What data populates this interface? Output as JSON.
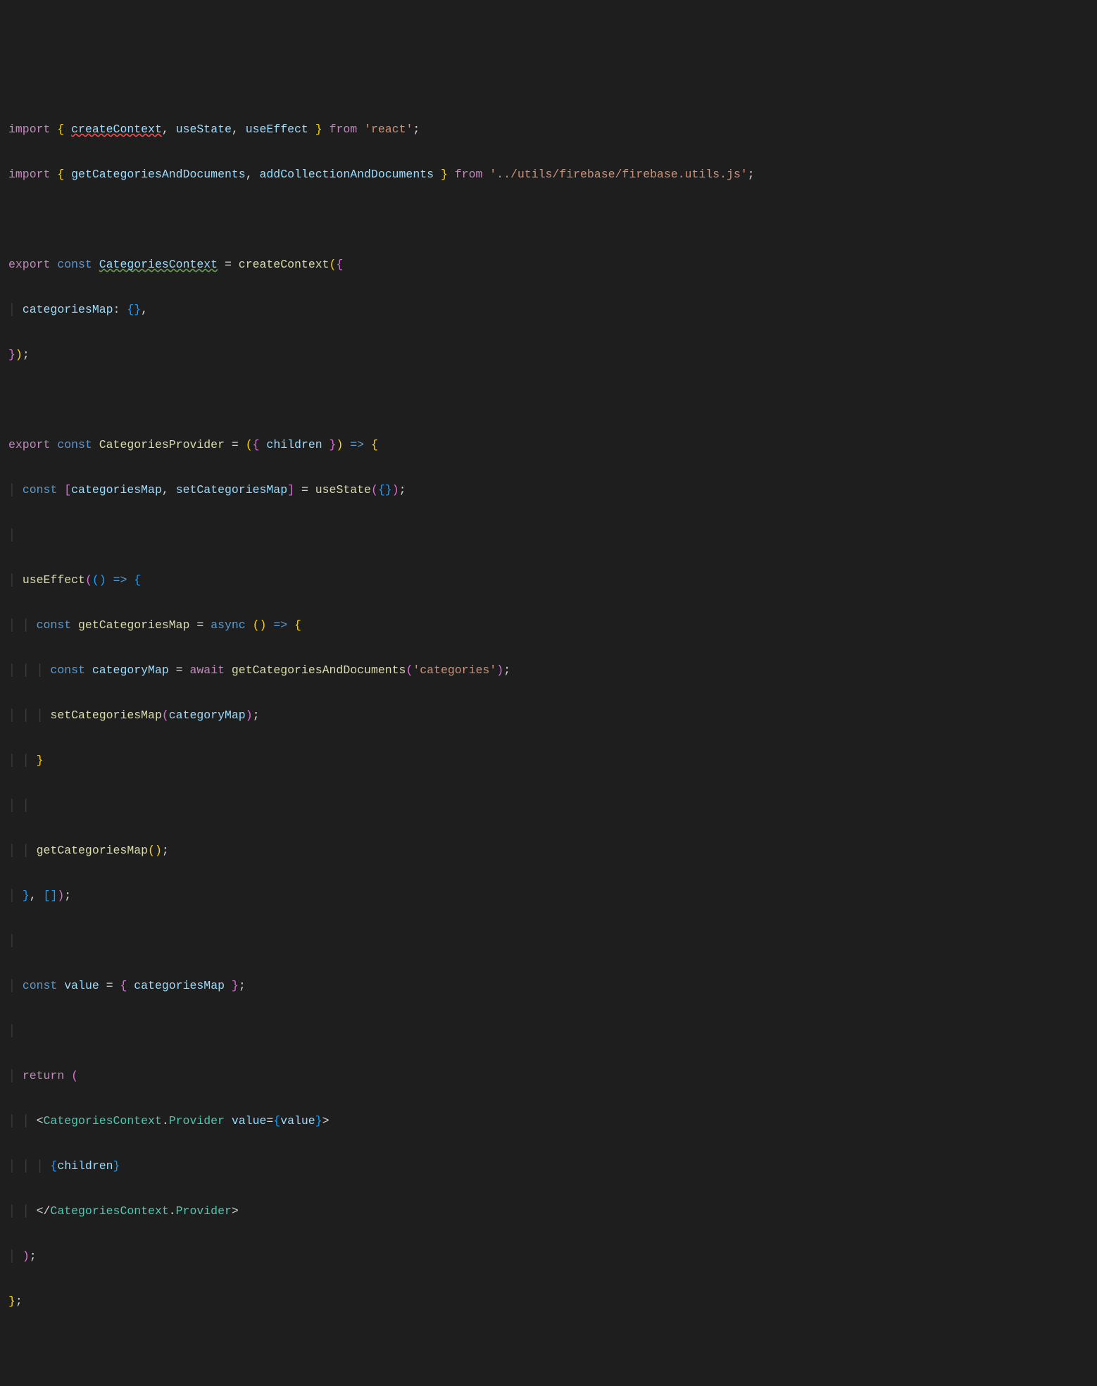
{
  "code": {
    "line1": {
      "import": "import",
      "brace_open": "{",
      "createContext": "createContext",
      "comma1": ",",
      "useState": "useState",
      "comma2": ",",
      "useEffect": "useEffect",
      "brace_close": "}",
      "from": "from",
      "module": "'react'",
      "semi": ";"
    },
    "line2": {
      "import": "import",
      "brace_open": "{",
      "getCategoriesAndDocuments": "getCategoriesAndDocuments",
      "comma": ",",
      "addCollectionAndDocuments": "addCollectionAndDocuments",
      "brace_close": "}",
      "from": "from",
      "module": "'../utils/firebase/firebase.utils.js'",
      "semi": ";"
    },
    "line4": {
      "export": "export",
      "const": "const",
      "CategoriesContext": "CategoriesContext",
      "eq": "=",
      "createContext": "createContext",
      "paren_open": "(",
      "brace_open": "{"
    },
    "line5": {
      "categoriesMap": "categoriesMap",
      "colon": ":",
      "braces": "{}",
      "comma": ","
    },
    "line6": {
      "brace_close": "}",
      "paren_close": ")",
      "semi": ";"
    },
    "line8": {
      "export": "export",
      "const": "const",
      "CategoriesProvider": "CategoriesProvider",
      "eq": "=",
      "paren_open": "(",
      "brace_open": "{",
      "children": "children",
      "brace_close": "}",
      "paren_close": ")",
      "arrow": "=>",
      "body_open": "{"
    },
    "line9": {
      "const": "const",
      "bracket_open": "[",
      "categoriesMap": "categoriesMap",
      "comma": ",",
      "setCategoriesMap": "setCategoriesMap",
      "bracket_close": "]",
      "eq": "=",
      "useState": "useState",
      "paren_open": "(",
      "braces": "{}",
      "paren_close": ")",
      "semi": ";"
    },
    "line11": {
      "useEffect": "useEffect",
      "paren_open": "(",
      "inner_paren_open": "(",
      "inner_paren_close": ")",
      "arrow": "=>",
      "brace_open": "{"
    },
    "line12": {
      "const": "const",
      "getCategoriesMap": "getCategoriesMap",
      "eq": "=",
      "async": "async",
      "paren_open": "(",
      "paren_close": ")",
      "arrow": "=>",
      "brace_open": "{"
    },
    "line13": {
      "const": "const",
      "categoryMap": "categoryMap",
      "eq": "=",
      "await": "await",
      "getCategoriesAndDocuments": "getCategoriesAndDocuments",
      "paren_open": "(",
      "arg": "'categories'",
      "paren_close": ")",
      "semi": ";"
    },
    "line14": {
      "setCategoriesMap": "setCategoriesMap",
      "paren_open": "(",
      "categoryMap": "categoryMap",
      "paren_close": ")",
      "semi": ";"
    },
    "line15": {
      "brace_close": "}"
    },
    "line17": {
      "getCategoriesMap": "getCategoriesMap",
      "parens": "()",
      "semi": ";"
    },
    "line18": {
      "brace_close": "}",
      "comma": ",",
      "bracket_open": "[",
      "bracket_close": "]",
      "paren_close": ")",
      "semi": ";"
    },
    "line20": {
      "const": "const",
      "value": "value",
      "eq": "=",
      "brace_open": "{",
      "categoriesMap": "categoriesMap",
      "brace_close": "}",
      "semi": ";"
    },
    "line22": {
      "return": "return",
      "paren_open": "("
    },
    "line23": {
      "lt": "<",
      "CategoriesContext": "CategoriesContext",
      "dot": ".",
      "Provider": "Provider",
      "value_attr": "value",
      "eq": "=",
      "brace_open": "{",
      "value_ref": "value",
      "brace_close": "}",
      "gt": ">"
    },
    "line24": {
      "brace_open": "{",
      "children": "children",
      "brace_close": "}"
    },
    "line25": {
      "lt_slash": "</",
      "CategoriesContext": "CategoriesContext",
      "dot": ".",
      "Provider": "Provider",
      "gt": ">"
    },
    "line26": {
      "paren_close": ")",
      "semi": ";"
    },
    "line27": {
      "brace_close": "}",
      "semi": ";"
    }
  }
}
